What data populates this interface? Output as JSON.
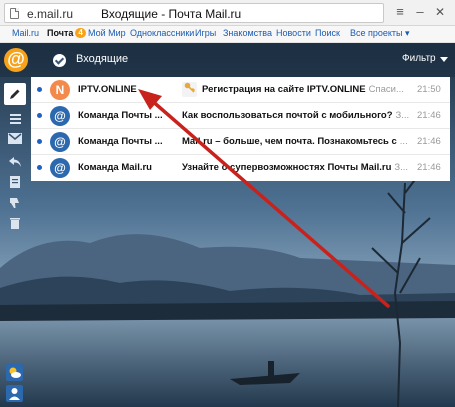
{
  "browser": {
    "domain": "e.mail.ru",
    "tab_title": "Входящие - Почта Mail.ru",
    "menu_icon": "≡",
    "minimize_icon": "–",
    "close_icon": "✕"
  },
  "portal_menu": {
    "items": [
      {
        "label": "Mail.ru",
        "active": false
      },
      {
        "label": "Почта",
        "active": true,
        "badge": "4"
      },
      {
        "label": "Мой Мир",
        "active": false
      },
      {
        "label": "Одноклассники",
        "active": false
      },
      {
        "label": "Игры",
        "active": false
      },
      {
        "label": "Знакомства",
        "active": false
      },
      {
        "label": "Новости",
        "active": false
      },
      {
        "label": "Поиск",
        "active": false
      },
      {
        "label": "Все проекты ▾",
        "active": false
      }
    ]
  },
  "header": {
    "logo": "@",
    "folder": "Входящие",
    "filter": "Фильтр"
  },
  "messages": [
    {
      "avatar_letter": "N",
      "avatar_color": "#f3894b",
      "sender": "IPTV.ONLINE",
      "has_key_icon": true,
      "subject": "Регистрация на сайте IPTV.ONLINE",
      "snippet": "Спаси...",
      "time": "21:50"
    },
    {
      "avatar_letter": "@",
      "avatar_color": "#2c68ad",
      "sender": "Команда Почты ...",
      "has_key_icon": false,
      "subject": "Как воспользоваться почтой с мобильного?",
      "snippet": "З...",
      "time": "21:46"
    },
    {
      "avatar_letter": "@",
      "avatar_color": "#2c68ad",
      "sender": "Команда Почты ...",
      "has_key_icon": false,
      "subject": "Mail.ru – больше, чем почта. Познакомьтесь с",
      "snippet": "...",
      "time": "21:46"
    },
    {
      "avatar_letter": "@",
      "avatar_color": "#2c68ad",
      "sender": "Команда Mail.ru",
      "has_key_icon": false,
      "subject": "Узнайте о суперв​озможностях Почты Mail.ru",
      "snippet": "З...",
      "time": "21:46"
    }
  ],
  "colors": {
    "accent_orange": "#f7a21b",
    "unread_blue": "#1a62c4",
    "annotation_red": "#c8221d"
  }
}
